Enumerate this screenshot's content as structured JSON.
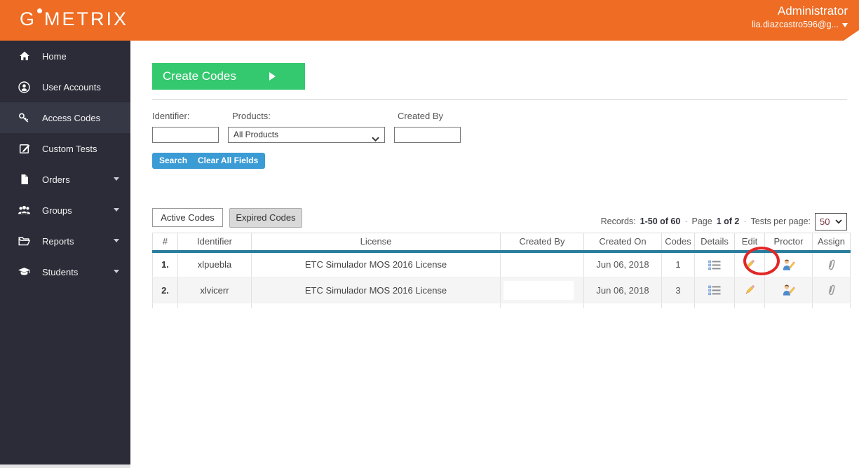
{
  "header": {
    "logo_g": "G",
    "logo_rest": "METRIX",
    "role": "Administrator",
    "email": "lia.diazcastro596@g..."
  },
  "sidebar": {
    "items": [
      {
        "label": "Home",
        "icon": "home-icon",
        "selected": false,
        "expandable": false
      },
      {
        "label": "User Accounts",
        "icon": "user-accounts-icon",
        "selected": false,
        "expandable": false
      },
      {
        "label": "Access Codes",
        "icon": "key-icon",
        "selected": true,
        "expandable": false
      },
      {
        "label": "Custom Tests",
        "icon": "edit-square-icon",
        "selected": false,
        "expandable": false
      },
      {
        "label": "Orders",
        "icon": "document-icon",
        "selected": false,
        "expandable": true
      },
      {
        "label": "Groups",
        "icon": "people-icon",
        "selected": false,
        "expandable": true
      },
      {
        "label": "Reports",
        "icon": "folder-icon",
        "selected": false,
        "expandable": true
      },
      {
        "label": "Students",
        "icon": "graduation-cap-icon",
        "selected": false,
        "expandable": true
      }
    ]
  },
  "main": {
    "create_codes": {
      "label": "Create Codes"
    },
    "filters": {
      "identifier": {
        "label": "Identifier:",
        "value": "",
        "placeholder": ""
      },
      "products": {
        "label": "Products:",
        "selected_option": "All Products"
      },
      "created_by": {
        "label": "Created By",
        "value": "",
        "placeholder": ""
      }
    },
    "actions": {
      "search": "Search",
      "clear": "Clear All Fields"
    },
    "tabs": {
      "active": "Active Codes",
      "expired": "Expired Codes"
    },
    "pagination": {
      "records_label": "Records:",
      "records_value": "1-50 of 60",
      "separator": "·",
      "page_label": "Page",
      "page_value": "1 of 2",
      "tests_per_page_label": "Tests per page:",
      "tests_per_page_value": "50"
    },
    "table": {
      "columns": [
        "#",
        "Identifier",
        "License",
        "Created By",
        "Created On",
        "Codes",
        "Details",
        "Edit",
        "Proctor",
        "Assign"
      ],
      "row_action_icons": [
        "list-details-icon",
        "pencil-edit-icon",
        "proctor-user-icon",
        "paperclip-assign-icon"
      ],
      "rows": [
        {
          "num": "1.",
          "identifier": "xlpuebla",
          "license": "ETC Simulador MOS 2016 License",
          "created_by": "",
          "created_on": "Jun 06, 2018",
          "codes": "1"
        },
        {
          "num": "2.",
          "identifier": "xlvicerr",
          "license": "ETC Simulador MOS 2016 License",
          "created_by": "",
          "created_on": "Jun 06, 2018",
          "codes": "3"
        }
      ]
    },
    "annotation": {
      "type": "red-circle-highlight",
      "target": "row-1-edit-icon",
      "color": "#e22727"
    }
  },
  "colors": {
    "header_orange": "#ee6c23",
    "sidebar_dark": "#2b2c37",
    "sidebar_selected": "#373846",
    "green_button": "#35c96f",
    "blue_button": "#3b9bd5",
    "table_header_line": "#2a7d9d",
    "annotation_red": "#e22727"
  }
}
